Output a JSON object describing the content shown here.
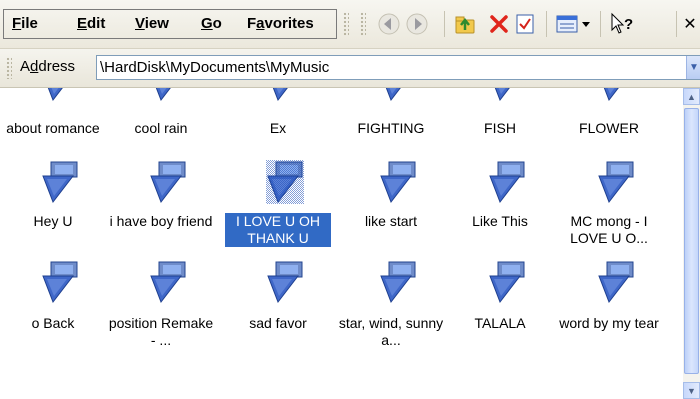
{
  "menu": {
    "file": {
      "u": "F",
      "rest": "ile"
    },
    "edit": {
      "u": "E",
      "rest": "dit"
    },
    "view": {
      "u": "V",
      "rest": "iew"
    },
    "go": {
      "u": "G",
      "rest": "o"
    },
    "favorites": {
      "pre": "F",
      "u": "a",
      "rest": "vorites"
    }
  },
  "toolbar": {
    "buttons": [
      "back-arrow-icon",
      "forward-arrow-icon",
      "up-folder-icon",
      "delete-icon",
      "properties-icon",
      "views-icon",
      "whats-this-icon",
      "close-icon"
    ],
    "help_glyph": "?",
    "close_glyph": "✕"
  },
  "address": {
    "label_pre": "A",
    "label_u": "d",
    "label_rest": "dress",
    "value": "\\HardDisk\\MyDocuments\\MyMusic"
  },
  "files": {
    "row1": [
      "about romance",
      "cool rain",
      "Ex",
      "FIGHTING",
      "FISH",
      "FLOWER"
    ],
    "row2": [
      "Hey U",
      "i have boy friend",
      "I LOVE U OH THANK U",
      "like start",
      "Like This",
      "MC mong - I LOVE U O..."
    ],
    "row3": [
      "o Back",
      "position Remake - ...",
      "sad favor",
      "star, wind, sunny a...",
      "TALALA",
      "word by my tear"
    ],
    "selected": "I LOVE U OH THANK U"
  },
  "colors": {
    "selection": "#316ac5",
    "icon_blue": "#3f67c8",
    "icon_light": "#8fb0ef"
  }
}
